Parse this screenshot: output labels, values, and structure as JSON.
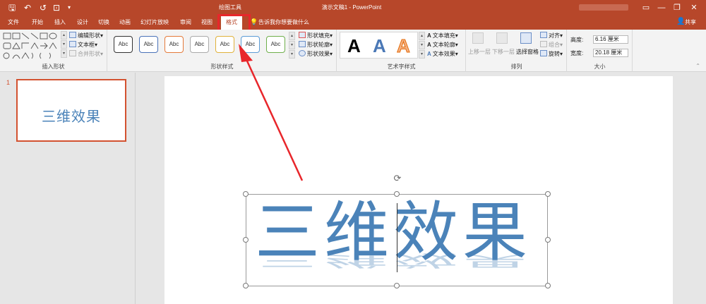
{
  "window": {
    "title": "演示文稿1 - PowerPoint",
    "contextual_group": "绘图工具",
    "account": "",
    "min": "—",
    "restore": "❐",
    "close": "✕"
  },
  "quick_access": {
    "save": "🖫",
    "undo": "↶",
    "redo": "↺",
    "present": "⊡",
    "more": "▾"
  },
  "tabs": [
    "文件",
    "开始",
    "插入",
    "设计",
    "切换",
    "动画",
    "幻灯片放映",
    "审阅",
    "视图",
    "格式"
  ],
  "tell_me": "告诉我你想要做什么",
  "share": "共享",
  "ribbon": {
    "insert_shapes": {
      "label": "插入形状",
      "edit_shape": "编辑形状",
      "text_box": "文本框",
      "merge_shapes": "合并形状"
    },
    "shape_styles": {
      "label": "形状样式",
      "swatches": [
        "Abc",
        "Abc",
        "Abc",
        "Abc",
        "Abc",
        "Abc",
        "Abc"
      ],
      "fill": "形状填充",
      "outline": "形状轮廓",
      "effects": "形状效果"
    },
    "wordart": {
      "label": "艺术字样式",
      "samples": [
        "A",
        "A",
        "A"
      ],
      "text_fill": "文本填充",
      "text_outline": "文本轮廓",
      "text_effects": "文本效果"
    },
    "arrange": {
      "label": "排列",
      "bring_forward": "上移一层",
      "send_backward": "下移一层",
      "selection_pane": "选择窗格",
      "align": "对齐",
      "group": "组合",
      "rotate": "旋转"
    },
    "size": {
      "label": "大小",
      "height_label": "高度:",
      "height_value": "6.16 厘米",
      "width_label": "宽度:",
      "width_value": "20.18 厘米"
    }
  },
  "slides": [
    {
      "number": "1",
      "text": "三维效果"
    }
  ],
  "slide": {
    "text": "三维效果"
  },
  "colors": {
    "accent": "#b7472a",
    "highlight": "#e8262b",
    "text": "#4b83b9"
  }
}
